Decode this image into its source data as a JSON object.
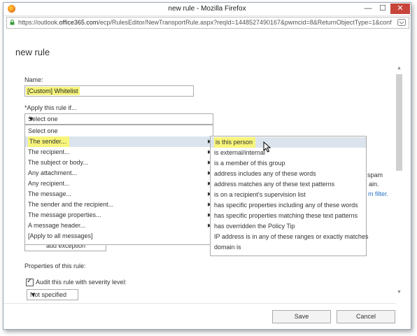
{
  "window": {
    "title": "new rule - Mozilla Firefox",
    "url_prefix": "https://outlook.",
    "url_domain": "office365.com",
    "url_suffix": "/ecp/RulesEditor/NewTransportRule.aspx?reqId=1448527490167&pwmcid=8&ReturnObjectType=1&conf",
    "min_label": "—",
    "max_label": "☐",
    "close_label": "✕"
  },
  "page": {
    "title": "new rule"
  },
  "form": {
    "name_label": "Name:",
    "name_value": "[Custom] Whitelist",
    "apply_label": "*Apply this rule if...",
    "apply_selected": "Select one",
    "add_exception_label": "add exception",
    "properties_label": "Properties of this rule:",
    "audit_label": "Audit this rule with severity level:",
    "audit_checked": true,
    "severity_value": "Not specified"
  },
  "dropdown": {
    "items": [
      {
        "label": "Select one",
        "has_submenu": false
      },
      {
        "label": "The sender...",
        "has_submenu": true,
        "active": true
      },
      {
        "label": "The recipient...",
        "has_submenu": true
      },
      {
        "label": "The subject or body...",
        "has_submenu": true
      },
      {
        "label": "Any attachment...",
        "has_submenu": true
      },
      {
        "label": "Any recipient...",
        "has_submenu": true
      },
      {
        "label": "The message...",
        "has_submenu": true
      },
      {
        "label": "The sender and the recipient...",
        "has_submenu": true
      },
      {
        "label": "The message properties...",
        "has_submenu": true
      },
      {
        "label": "A message header...",
        "has_submenu": true
      },
      {
        "label": "[Apply to all messages]",
        "has_submenu": false
      }
    ]
  },
  "submenu": {
    "items": [
      {
        "label": "is this person",
        "active": true
      },
      {
        "label": "is external/internal"
      },
      {
        "label": "is a member of this group"
      },
      {
        "label": "address includes any of these words"
      },
      {
        "label": "address matches any of these text patterns"
      },
      {
        "label": "is on a recipient's supervision list"
      },
      {
        "label": "has specific properties including any of these words"
      },
      {
        "label": "has specific properties matching these text patterns"
      },
      {
        "label": "has overridden the Policy Tip"
      },
      {
        "label": "IP address is in any of these ranges or exactly matches"
      },
      {
        "label": "domain is"
      }
    ]
  },
  "side_fragments": {
    "spam": "spam",
    "ain": "ain.",
    "filter_link": "m filter."
  },
  "buttons": {
    "save": "Save",
    "cancel": "Cancel"
  },
  "icons": {
    "browser": "firefox-icon",
    "lock": "lock-icon",
    "cursor": "mouse-pointer-icon"
  },
  "colors": {
    "highlight": "#f7f57a",
    "close_button": "#c7443a",
    "link": "#2a72c9",
    "hover_row": "#dbe4ec"
  }
}
